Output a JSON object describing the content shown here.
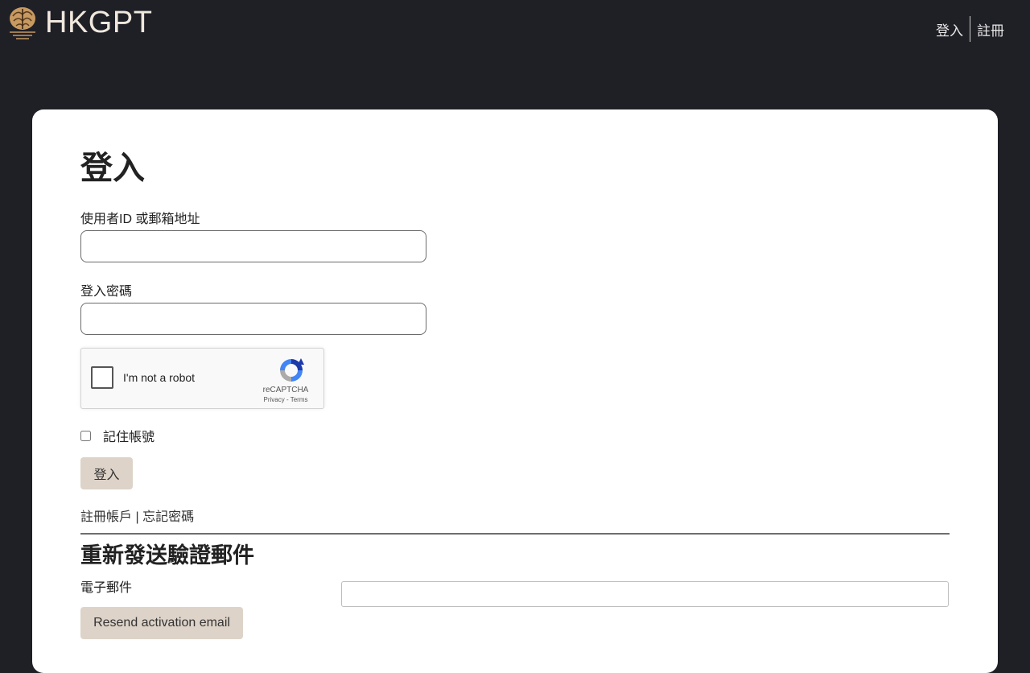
{
  "header": {
    "brand": "HKGPT",
    "nav": {
      "login": "登入",
      "register": "註冊"
    }
  },
  "login": {
    "title": "登入",
    "user_label": "使用者ID 或郵箱地址",
    "password_label": "登入密碼",
    "remember_label": "記住帳號",
    "submit_label": "登入",
    "register_link": "註冊帳戶",
    "links_separator": "|",
    "forgot_link": "忘記密碼"
  },
  "captcha": {
    "text": "I'm not a robot",
    "brand": "reCAPTCHA",
    "privacy": "Privacy",
    "links_separator": "-",
    "terms": "Terms"
  },
  "resend": {
    "title": "重新發送驗證郵件",
    "email_label": "電子郵件",
    "button_label": "Resend activation email"
  },
  "colors": {
    "background": "#1f1f26",
    "card": "#ffffff",
    "button": "#ddd3c8",
    "brand_text": "#f0e8de"
  }
}
